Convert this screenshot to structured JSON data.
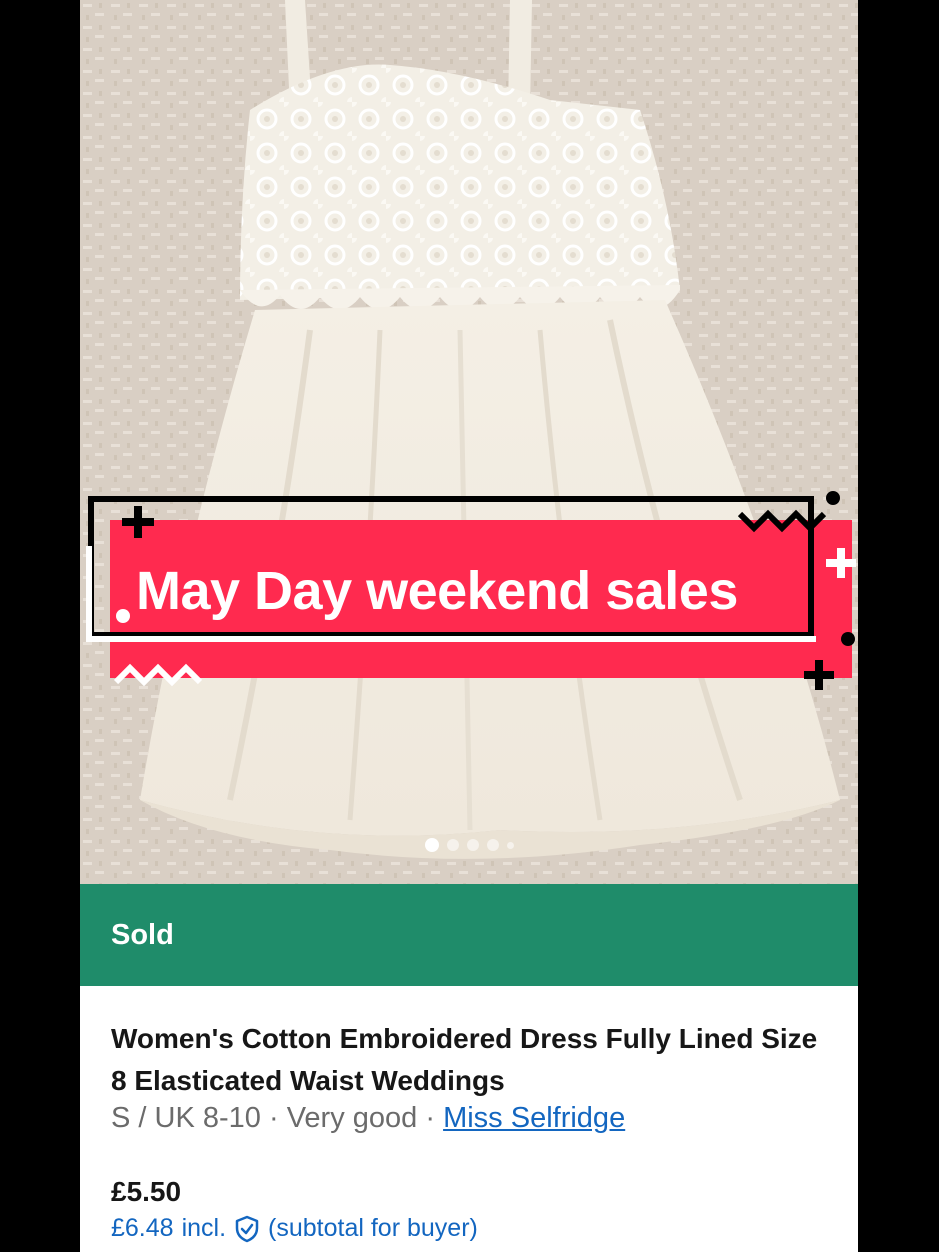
{
  "banner": {
    "text": "May Day weekend sales"
  },
  "gallery": {
    "image_count": 5,
    "active_index": 0
  },
  "status": {
    "label": "Sold"
  },
  "listing": {
    "title": "Women's Cotton Embroidered Dress Fully Lined Size 8 Elasticated Waist Weddings",
    "size": "S / UK 8-10",
    "separator": " · ",
    "condition": "Very good",
    "brand": "Miss Selfridge",
    "price": "£5.50",
    "buyer_price": "£6.48",
    "buyer_price_incl": "incl.",
    "buyer_price_note": "(subtotal for buyer)"
  },
  "colors": {
    "status_green": "#1f8c6a",
    "banner_red": "#ff2a4f",
    "link_blue": "#1366c0"
  },
  "icons": {
    "protection": "shield-check-icon"
  }
}
